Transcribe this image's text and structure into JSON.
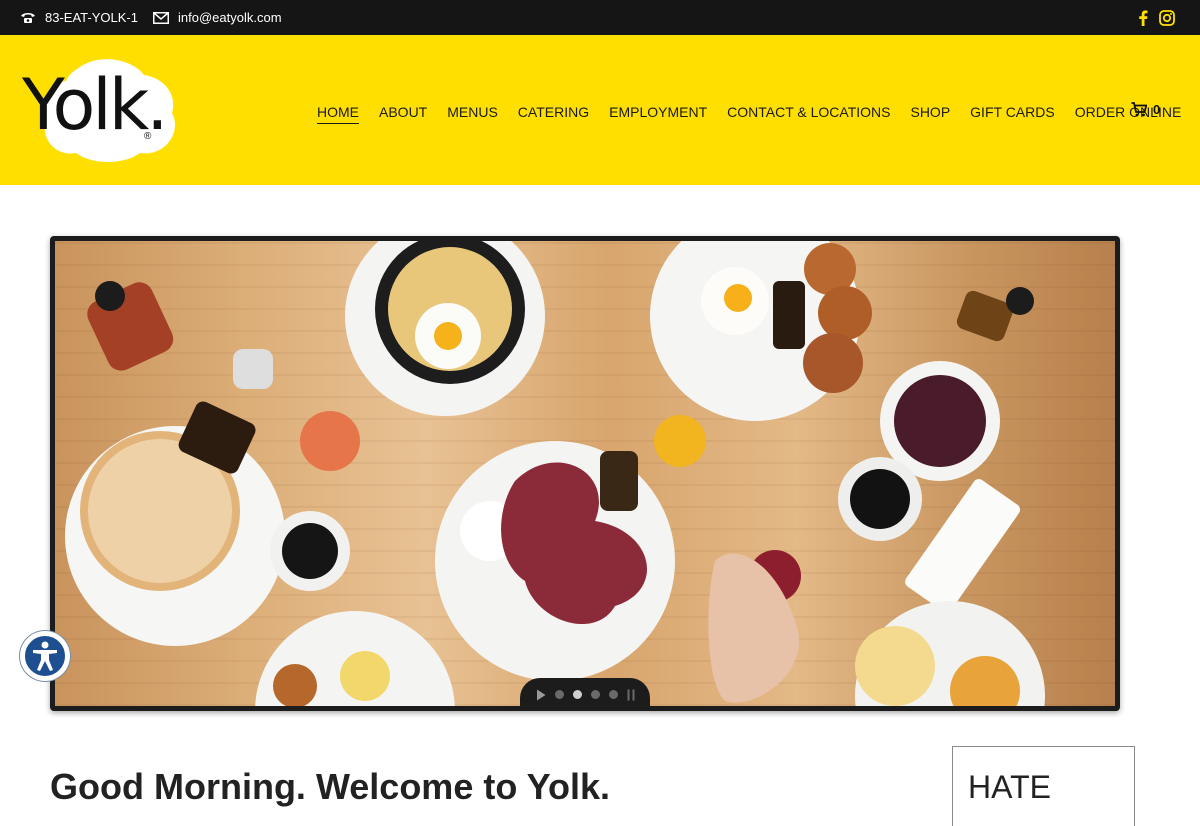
{
  "topbar": {
    "phone": "83-EAT-YOLK-1",
    "email": "info@eatyolk.com",
    "social": [
      {
        "icon": "facebook-icon"
      },
      {
        "icon": "instagram-icon"
      }
    ],
    "icon_color": "#ffdf00"
  },
  "header": {
    "logo_text": "Yolk.",
    "logo_reg": "®",
    "background": "#ffdf00",
    "nav": [
      {
        "label": "HOME",
        "active": true
      },
      {
        "label": "ABOUT"
      },
      {
        "label": "MENUS"
      },
      {
        "label": "CATERING"
      },
      {
        "label": "EMPLOYMENT"
      },
      {
        "label": "CONTACT & LOCATIONS"
      },
      {
        "label": "SHOP"
      },
      {
        "label": "GIFT CARDS"
      },
      {
        "label": "ORDER ONLINE"
      }
    ],
    "cart_count": "0"
  },
  "slider": {
    "slide_count": 4,
    "active_slide": 2,
    "image_description_icon": "breakfast-spread-image"
  },
  "main": {
    "welcome_heading": "Good Morning. Welcome to Yolk.",
    "sidebar_heading": "HATE"
  }
}
